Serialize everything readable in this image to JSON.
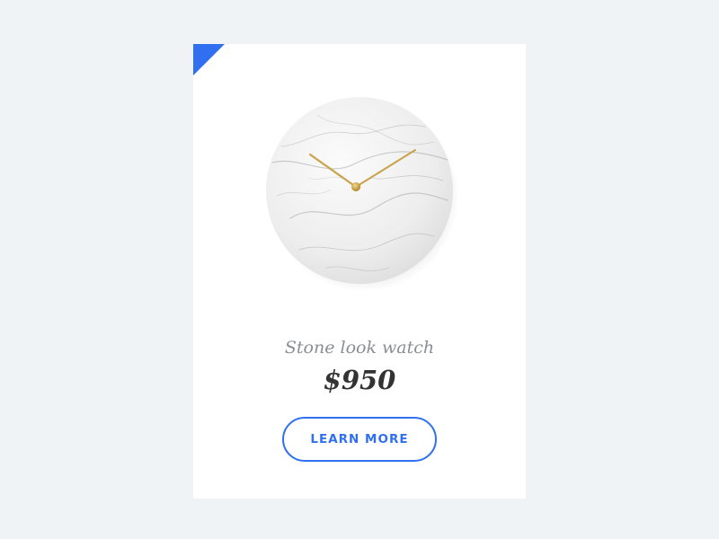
{
  "card": {
    "accent_color": "#2f6ff0",
    "image_icon": "marble-wall-clock",
    "product_name": "Stone look watch",
    "price": "$950",
    "cta_label": "LEARN MORE"
  }
}
